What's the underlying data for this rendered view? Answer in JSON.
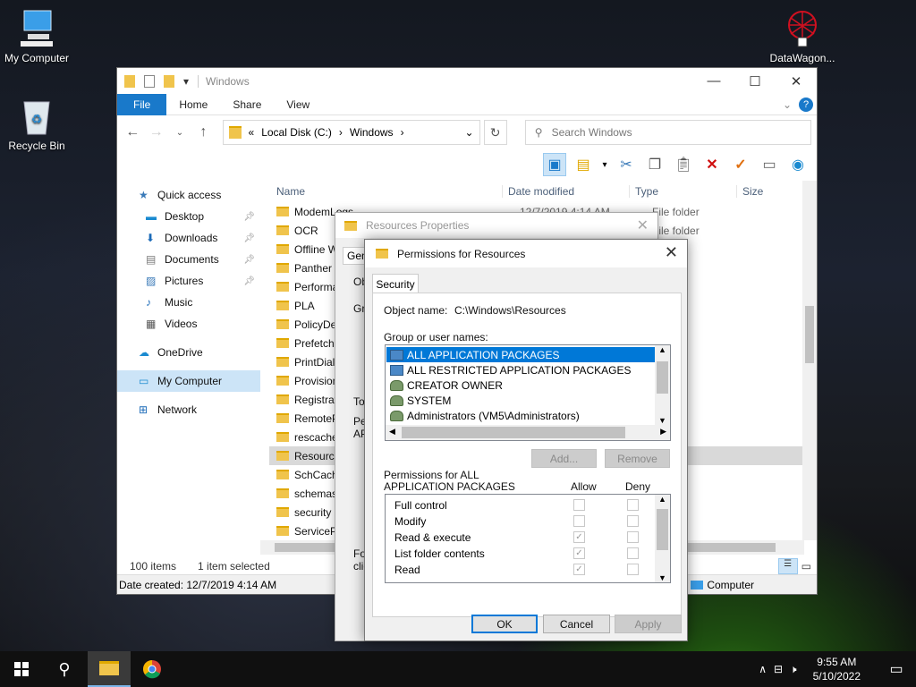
{
  "desktop": {
    "icons": [
      {
        "label": "My Computer"
      },
      {
        "label": "Recycle Bin"
      },
      {
        "label": "DataWagon..."
      }
    ]
  },
  "explorer": {
    "title": "Windows",
    "ribbon_tabs": [
      "File",
      "Home",
      "Share",
      "View"
    ],
    "address": {
      "prefix": "«",
      "segments": [
        "Local Disk (C:)",
        "Windows"
      ]
    },
    "search_placeholder": "Search Windows",
    "nav": [
      {
        "label": "Quick access",
        "pinned": false
      },
      {
        "label": "Desktop",
        "pinned": true
      },
      {
        "label": "Downloads",
        "pinned": true
      },
      {
        "label": "Documents",
        "pinned": true
      },
      {
        "label": "Pictures",
        "pinned": true
      },
      {
        "label": "Music",
        "pinned": false
      },
      {
        "label": "Videos",
        "pinned": false
      },
      {
        "label": "OneDrive",
        "pinned": false
      },
      {
        "label": "My Computer",
        "pinned": false,
        "selected": true
      },
      {
        "label": "Network",
        "pinned": false
      }
    ],
    "columns": {
      "name": "Name",
      "date": "Date modified",
      "type": "Type",
      "size": "Size"
    },
    "files": [
      {
        "name": "ModemLogs",
        "date": "12/7/2019 4:14 AM",
        "type": "File folder"
      },
      {
        "name": "OCR",
        "date": "",
        "type": "File folder"
      },
      {
        "name": "Offline W",
        "date": "",
        "type": ""
      },
      {
        "name": "Panther",
        "date": "",
        "type": ""
      },
      {
        "name": "Performa",
        "date": "",
        "type": ""
      },
      {
        "name": "PLA",
        "date": "",
        "type": ""
      },
      {
        "name": "PolicyDe",
        "date": "",
        "type": ""
      },
      {
        "name": "Prefetch",
        "date": "",
        "type": ""
      },
      {
        "name": "PrintDial",
        "date": "",
        "type": ""
      },
      {
        "name": "Provision",
        "date": "",
        "type": ""
      },
      {
        "name": "Registrat",
        "date": "",
        "type": ""
      },
      {
        "name": "RemoteP",
        "date": "",
        "type": ""
      },
      {
        "name": "rescache",
        "date": "",
        "type": ""
      },
      {
        "name": "Resource",
        "date": "",
        "type": "",
        "selected": true
      },
      {
        "name": "SchCach",
        "date": "",
        "type": ""
      },
      {
        "name": "schemas",
        "date": "",
        "type": ""
      },
      {
        "name": "security",
        "date": "",
        "type": ""
      },
      {
        "name": "ServiceP",
        "date": "",
        "type": ""
      }
    ],
    "status": {
      "count": "100 items",
      "selected": "1 item selected"
    },
    "details": {
      "created": "Date created: 12/7/2019 4:14 AM",
      "location": "Computer"
    }
  },
  "resprops": {
    "title": "Resources Properties",
    "tab_partial": "Gen",
    "partial_labels": [
      "Ob",
      "Gro",
      "To",
      "Pe",
      "AP",
      "Fo",
      "clic"
    ]
  },
  "perm": {
    "title": "Permissions for Resources",
    "tab": "Security",
    "object_label": "Object name:",
    "object_value": "C:\\Windows\\Resources",
    "group_label": "Group or user names:",
    "users": [
      {
        "name": "ALL APPLICATION PACKAGES",
        "icon": "package-icon",
        "selected": true
      },
      {
        "name": "ALL RESTRICTED APPLICATION PACKAGES",
        "icon": "package-icon"
      },
      {
        "name": "CREATOR OWNER",
        "icon": "users-group-icon"
      },
      {
        "name": "SYSTEM",
        "icon": "users-group-icon"
      },
      {
        "name": "Administrators (VM5\\Administrators)",
        "icon": "users-group-icon"
      }
    ],
    "add_label": "Add...",
    "remove_label": "Remove",
    "perm_label_1": "Permissions for ALL",
    "perm_label_2": "APPLICATION PACKAGES",
    "allow_label": "Allow",
    "deny_label": "Deny",
    "permissions": [
      {
        "name": "Full control",
        "allow": false,
        "deny": false
      },
      {
        "name": "Modify",
        "allow": false,
        "deny": false
      },
      {
        "name": "Read & execute",
        "allow": true,
        "deny": false
      },
      {
        "name": "List folder contents",
        "allow": true,
        "deny": false
      },
      {
        "name": "Read",
        "allow": true,
        "deny": false
      }
    ],
    "ok_label": "OK",
    "cancel_label": "Cancel",
    "apply_label": "Apply"
  },
  "taskbar": {
    "time": "9:55 AM",
    "date": "5/10/2022"
  },
  "colors": {
    "accent": "#0078d7",
    "file_tab": "#1979ca",
    "folder": "#f0c44c"
  }
}
